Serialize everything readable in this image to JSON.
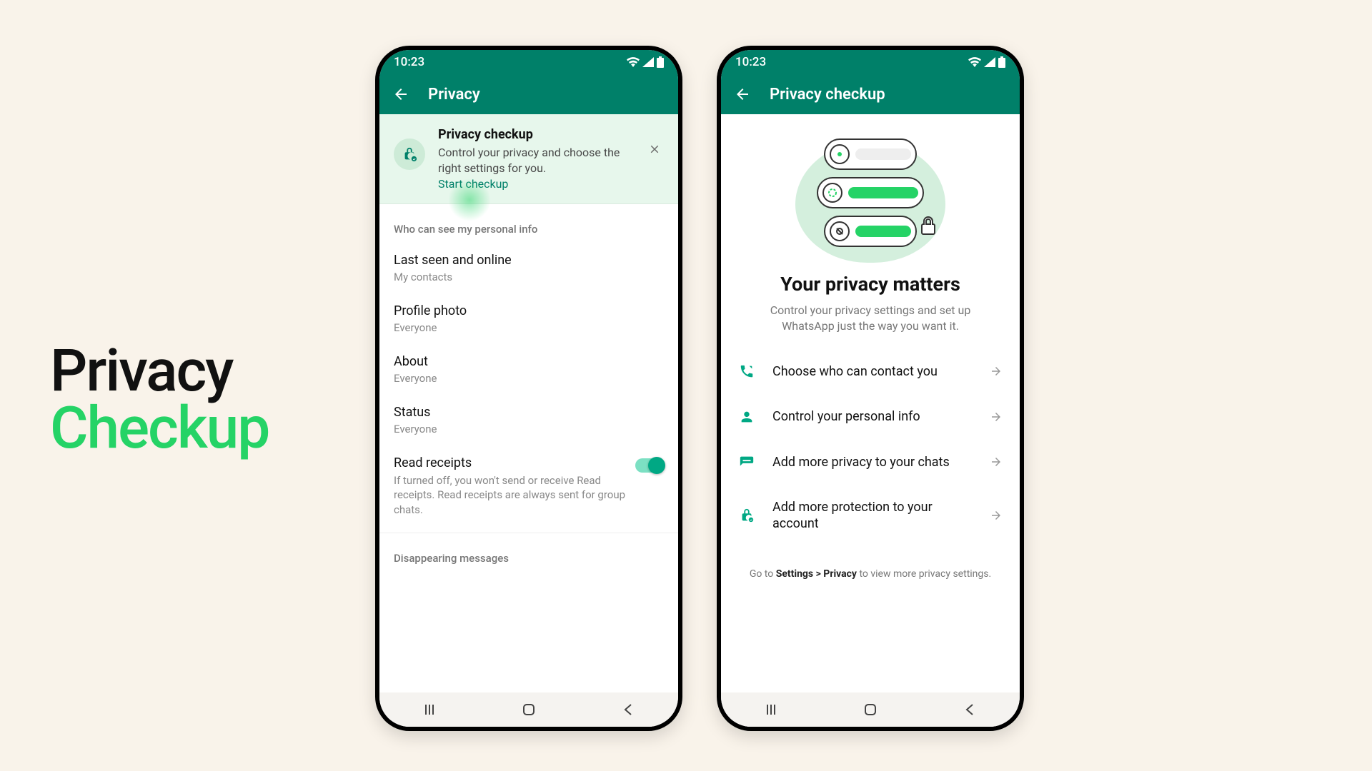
{
  "hero": {
    "line1": "Privacy",
    "line2": "Checkup"
  },
  "statusbar": {
    "time": "10:23"
  },
  "phone1": {
    "title": "Privacy",
    "banner": {
      "title": "Privacy checkup",
      "text": "Control your privacy and choose the right settings for you.",
      "link": "Start checkup"
    },
    "section1_label": "Who can see my personal info",
    "settings": {
      "last_seen": {
        "title": "Last seen and online",
        "value": "My contacts"
      },
      "photo": {
        "title": "Profile photo",
        "value": "Everyone"
      },
      "about": {
        "title": "About",
        "value": "Everyone"
      },
      "status": {
        "title": "Status",
        "value": "Everyone"
      },
      "read_receipts": {
        "title": "Read receipts",
        "desc": "If turned off, you won't send or receive Read receipts. Read receipts are always sent for group chats."
      }
    },
    "section2_label": "Disappearing messages"
  },
  "phone2": {
    "title": "Privacy checkup",
    "heading": "Your privacy matters",
    "subtext": "Control your privacy settings and set up WhatsApp just the way you want it.",
    "items": [
      "Choose who can contact you",
      "Control your personal info",
      "Add more privacy to your chats",
      "Add more protection to your account"
    ],
    "footer_pre": "Go to ",
    "footer_bold": "Settings > Privacy",
    "footer_post": " to view more privacy settings."
  }
}
